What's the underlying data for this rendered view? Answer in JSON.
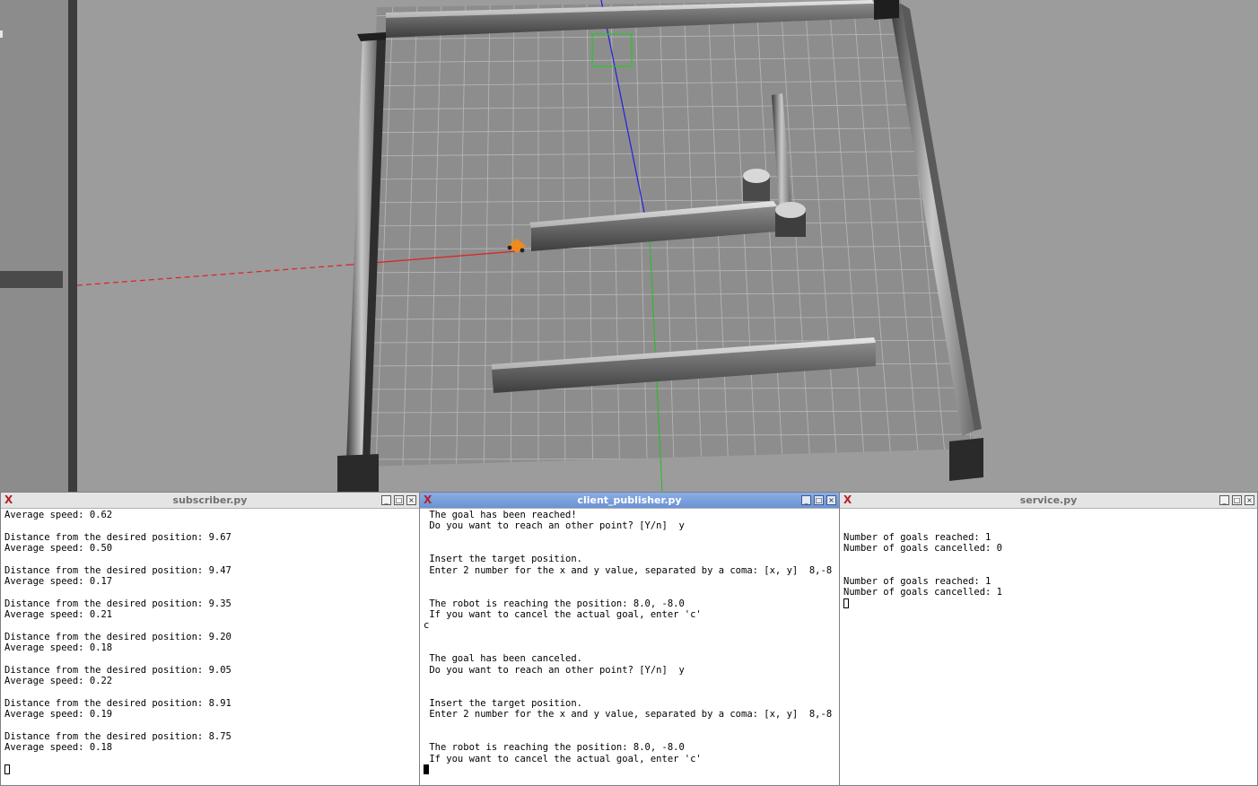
{
  "windows": [
    {
      "id": "subscriber",
      "title": "subscriber.py",
      "active": false,
      "lines": [
        "Average speed: 0.62",
        "",
        "Distance from the desired position: 9.67",
        "Average speed: 0.50",
        "",
        "Distance from the desired position: 9.47",
        "Average speed: 0.17",
        "",
        "Distance from the desired position: 9.35",
        "Average speed: 0.21",
        "",
        "Distance from the desired position: 9.20",
        "Average speed: 0.18",
        "",
        "Distance from the desired position: 9.05",
        "Average speed: 0.22",
        "",
        "Distance from the desired position: 8.91",
        "Average speed: 0.19",
        "",
        "Distance from the desired position: 8.75",
        "Average speed: 0.18",
        ""
      ],
      "cursor": "outline"
    },
    {
      "id": "client_publisher",
      "title": "client_publisher.py",
      "active": true,
      "lines": [
        " The goal has been reached!",
        " Do you want to reach an other point? [Y/n]  y",
        "",
        "",
        " Insert the target position.",
        " Enter 2 number for the x and y value, separated by a coma: [x, y]  8,-8",
        "",
        "",
        " The robot is reaching the position: 8.0, -8.0",
        " If you want to cancel the actual goal, enter 'c'",
        "c",
        "",
        "",
        " The goal has been canceled.",
        " Do you want to reach an other point? [Y/n]  y",
        "",
        "",
        " Insert the target position.",
        " Enter 2 number for the x and y value, separated by a coma: [x, y]  8,-8",
        "",
        "",
        " The robot is reaching the position: 8.0, -8.0",
        " If you want to cancel the actual goal, enter 'c'"
      ],
      "cursor": "solid"
    },
    {
      "id": "service",
      "title": "service.py",
      "active": false,
      "lines": [
        "",
        "",
        "Number of goals reached: 1",
        "Number of goals cancelled: 0",
        "",
        "",
        "Number of goals reached: 1",
        "Number of goals cancelled: 1"
      ],
      "cursor": "outline"
    }
  ],
  "colors": {
    "active_titlebar": "#6b92d4",
    "axis_x": "#e02020",
    "axis_y": "#2020e0",
    "axis_z": "#20c020",
    "goal_marker": "#22cc22",
    "robot": "#f08a1c"
  },
  "icons": {
    "window_menu": "xterm-icon",
    "minimize": "minimize-icon",
    "maximize": "maximize-icon",
    "close": "close-icon"
  }
}
